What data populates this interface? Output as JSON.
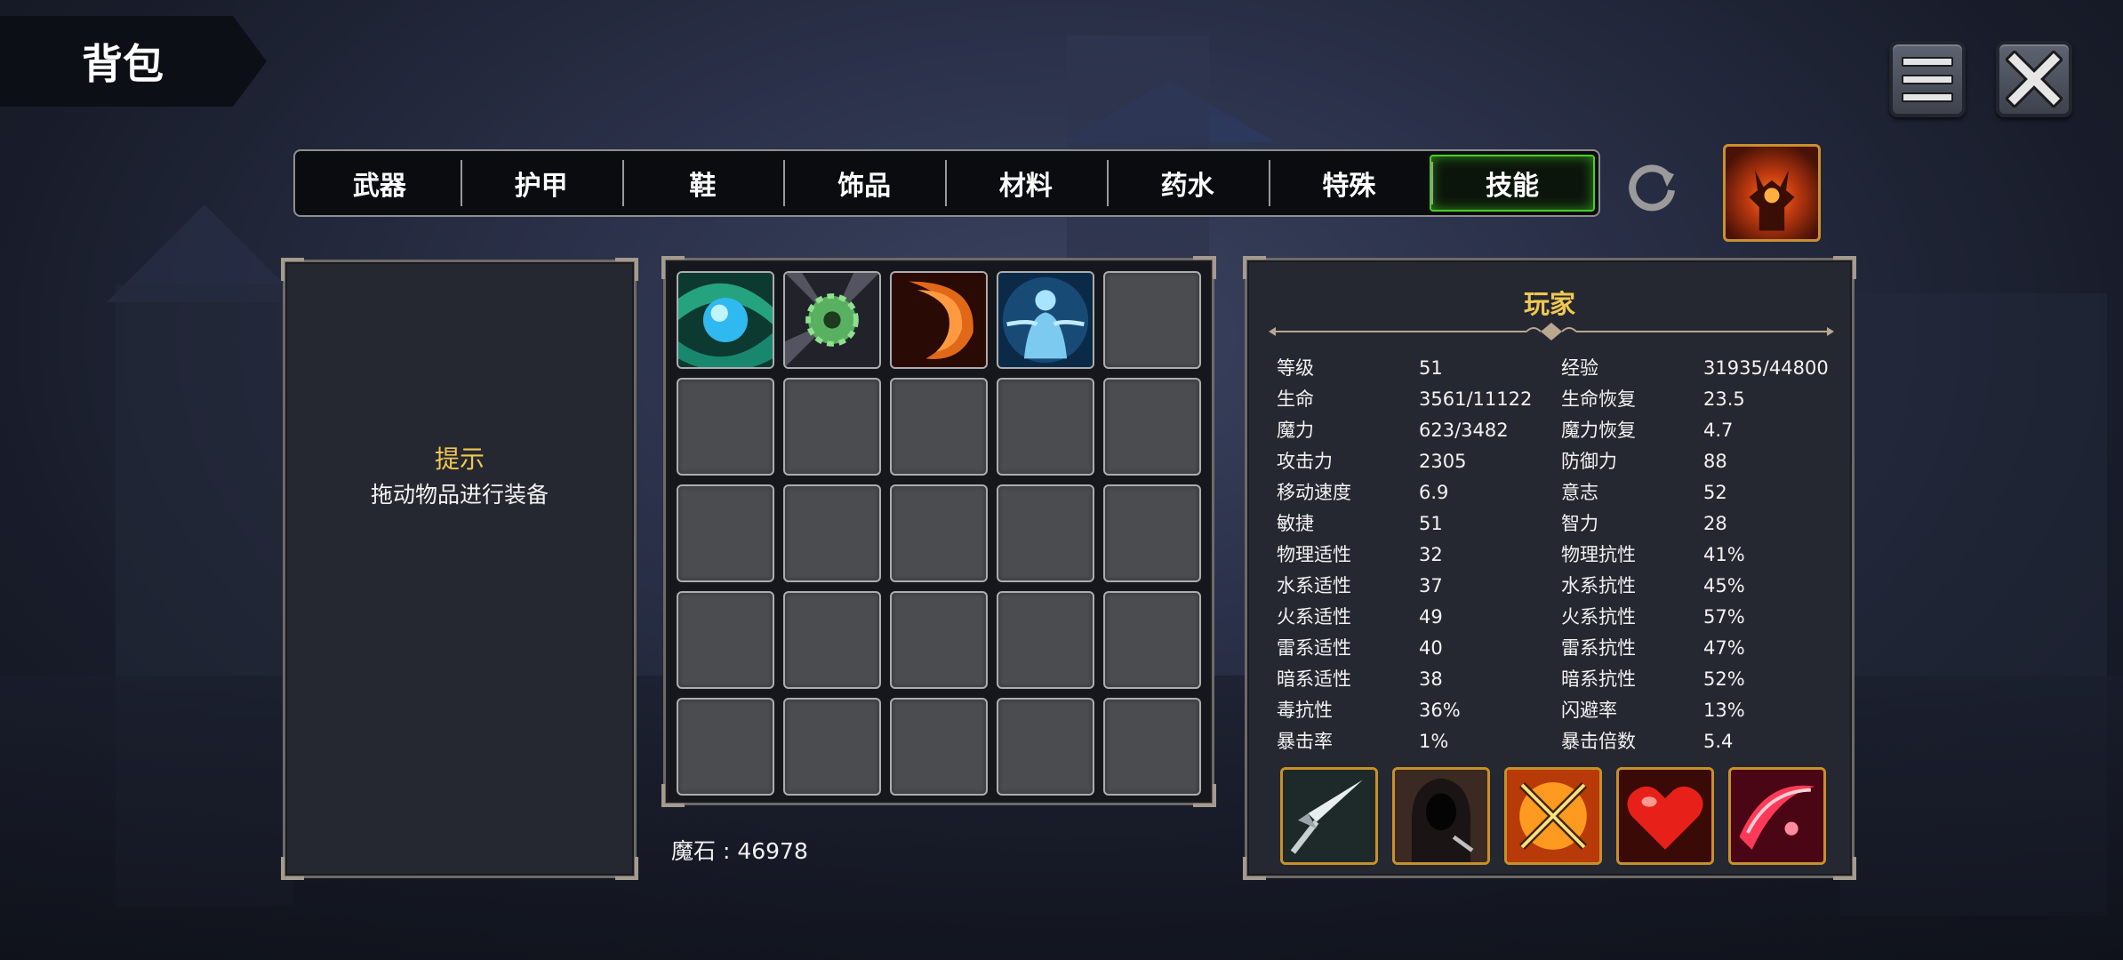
{
  "title": "背包",
  "tabs": [
    {
      "label": "武器",
      "active": false
    },
    {
      "label": "护甲",
      "active": false
    },
    {
      "label": "鞋",
      "active": false
    },
    {
      "label": "饰品",
      "active": false
    },
    {
      "label": "材料",
      "active": false
    },
    {
      "label": "药水",
      "active": false
    },
    {
      "label": "特殊",
      "active": false
    },
    {
      "label": "技能",
      "active": true
    }
  ],
  "hint": {
    "title": "提示",
    "text": "拖动物品进行装备"
  },
  "inventory": {
    "slots": [
      {
        "icon": "water-orb-skill-icon"
      },
      {
        "icon": "spinning-blade-skill-icon"
      },
      {
        "icon": "fire-slash-skill-icon"
      },
      {
        "icon": "spirit-figure-skill-icon"
      },
      {
        "icon": "empty"
      }
    ],
    "rows": 5,
    "cols": 5
  },
  "currency": "魔石 : 46978",
  "stats": {
    "title": "玩家",
    "rows": [
      [
        "等级",
        "51",
        "经验",
        "31935/44800"
      ],
      [
        "生命",
        "3561/11122",
        "生命恢复",
        "23.5"
      ],
      [
        "魔力",
        "623/3482",
        "魔力恢复",
        "4.7"
      ],
      [
        "攻击力",
        "2305",
        "防御力",
        "88"
      ],
      [
        "移动速度",
        "6.9",
        "意志",
        "52"
      ],
      [
        "敏捷",
        "51",
        "智力",
        "28"
      ],
      [
        "物理适性",
        "32",
        "物理抗性",
        "41%"
      ],
      [
        "水系适性",
        "37",
        "水系抗性",
        "45%"
      ],
      [
        "火系适性",
        "49",
        "火系抗性",
        "57%"
      ],
      [
        "雷系适性",
        "40",
        "雷系抗性",
        "47%"
      ],
      [
        "暗系适性",
        "38",
        "暗系抗性",
        "52%"
      ],
      [
        "毒抗性",
        "36%",
        "闪避率",
        "13%"
      ],
      [
        "暴击率",
        "1%",
        "暴击倍数",
        "5.4"
      ]
    ],
    "equipped_skills": [
      "spear-thrust-skill-icon",
      "hooded-assassin-skill-icon",
      "crossed-swords-skill-icon",
      "heart-skill-icon",
      "crimson-slash-skill-icon"
    ]
  },
  "colors": {
    "accent_gold": "#f0c850",
    "active_tab_green": "#48d028",
    "frame_gold": "#c8902a"
  }
}
